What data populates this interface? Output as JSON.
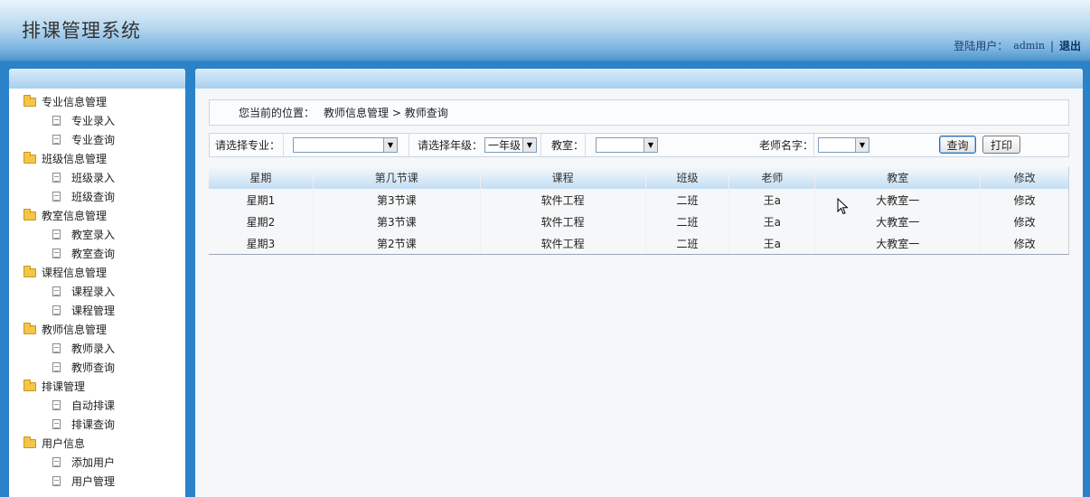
{
  "header": {
    "title": "排课管理系统",
    "user_label": "登陆用户：",
    "user_name": "admin",
    "separator": "|",
    "logout": "退出"
  },
  "sidebar": {
    "groups": [
      {
        "label": "专业信息管理",
        "items": [
          "专业录入",
          "专业查询"
        ]
      },
      {
        "label": "班级信息管理",
        "items": [
          "班级录入",
          "班级查询"
        ]
      },
      {
        "label": "教室信息管理",
        "items": [
          "教室录入",
          "教室查询"
        ]
      },
      {
        "label": "课程信息管理",
        "items": [
          "课程录入",
          "课程管理"
        ]
      },
      {
        "label": "教师信息管理",
        "items": [
          "教师录入",
          "教师查询"
        ]
      },
      {
        "label": "排课管理",
        "items": [
          "自动排课",
          "排课查询"
        ]
      },
      {
        "label": "用户信息",
        "items": [
          "添加用户",
          "用户管理"
        ]
      }
    ]
  },
  "breadcrumb": {
    "prefix": "您当前的位置：",
    "path1": "教师信息管理",
    "arrow": ">",
    "path2": "教师查询"
  },
  "filters": {
    "major_label": "请选择专业：",
    "major_value": "",
    "grade_label": "请选择年级：",
    "grade_value": "一年级",
    "room_label": "教室：",
    "room_value": "",
    "teacher_label": "老师名字：",
    "teacher_value": "",
    "query_button": "查询",
    "print_button": "打印"
  },
  "table": {
    "headers": [
      "星期",
      "第几节课",
      "课程",
      "班级",
      "老师",
      "教室",
      "修改"
    ],
    "rows": [
      [
        "星期1",
        "第3节课",
        "软件工程",
        "二班",
        "王a",
        "大教室一",
        "修改"
      ],
      [
        "星期2",
        "第3节课",
        "软件工程",
        "二班",
        "王a",
        "大教室一",
        "修改"
      ],
      [
        "星期3",
        "第2节课",
        "软件工程",
        "二班",
        "王a",
        "大教室一",
        "修改"
      ]
    ]
  }
}
